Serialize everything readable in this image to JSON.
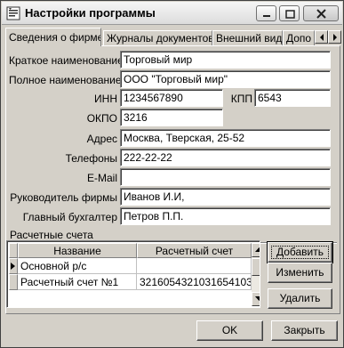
{
  "window": {
    "title": "Настройки программы",
    "controls": {
      "minimize": "minimize-icon",
      "maximize": "maximize-icon",
      "close": "close-icon"
    }
  },
  "tabs": [
    {
      "label": "Сведения о фирме",
      "active": true
    },
    {
      "label": "Журналы документов",
      "active": false
    },
    {
      "label": "Внешний вид",
      "active": false
    },
    {
      "label": "Допо",
      "active": false
    }
  ],
  "form": {
    "short_name": {
      "label": "Краткое наименование",
      "value": "Торговый мир"
    },
    "full_name": {
      "label": "Полное наименование",
      "value": "ООО \"Торговый мир\""
    },
    "inn": {
      "label": "ИНН",
      "value": "1234567890"
    },
    "kpp": {
      "label": "КПП",
      "value": "6543"
    },
    "okpo": {
      "label": "ОКПО",
      "value": "3216"
    },
    "address": {
      "label": "Адрес",
      "value": "Москва, Тверская, 25-52"
    },
    "phones": {
      "label": "Телефоны",
      "value": "222-22-22"
    },
    "email": {
      "label": "E-Mail",
      "value": ""
    },
    "director": {
      "label": "Руководитель фирмы",
      "value": "Иванов И.И,"
    },
    "accountant": {
      "label": "Главный бухгалтер",
      "value": "Петров П.П."
    }
  },
  "accounts": {
    "title": "Расчетные счета",
    "columns": [
      "Название",
      "Расчетный счет"
    ],
    "rows": [
      {
        "name": "Основной р/с",
        "number": "",
        "current": true
      },
      {
        "name": "Расчетный счет №1",
        "number": "3216054321031654103",
        "current": false
      }
    ],
    "buttons": {
      "add": "Добавить",
      "edit": "Изменить",
      "delete": "Удалить"
    }
  },
  "footer": {
    "ok": "OK",
    "close": "Закрыть"
  }
}
